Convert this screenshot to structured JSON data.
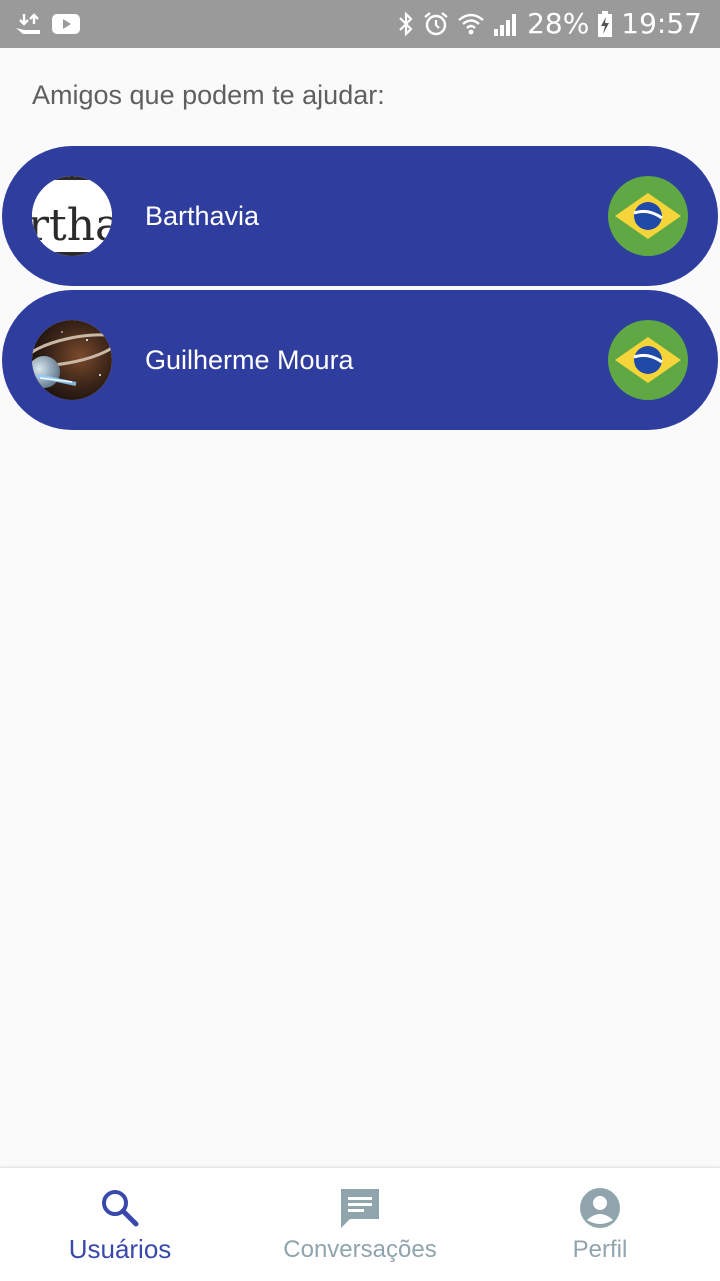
{
  "status_bar": {
    "battery_percent": "28%",
    "time": "19:57",
    "left_icons": [
      "download-upload-icon",
      "youtube-icon"
    ],
    "right_icons": [
      "bluetooth-icon",
      "alarm-icon",
      "wifi-icon",
      "signal-icon",
      "battery-charging-icon"
    ]
  },
  "main": {
    "title": "Amigos que podem te ajudar:",
    "friends": [
      {
        "name": "Barthavia",
        "avatar_text": "rtha",
        "flag": "brazil-flag-icon"
      },
      {
        "name": "Guilherme Moura",
        "avatar": "planet-avatar",
        "flag": "brazil-flag-icon"
      }
    ]
  },
  "bottom_nav": {
    "items": [
      {
        "label": "Usuários",
        "icon": "search-icon",
        "active": true
      },
      {
        "label": "Conversações",
        "icon": "chat-icon",
        "active": false
      },
      {
        "label": "Perfil",
        "icon": "account-icon",
        "active": false
      }
    ]
  },
  "colors": {
    "card_background": "#2f3d9f",
    "active_nav": "#3949ab",
    "inactive_nav": "#90a4ae",
    "status_bar": "#9a9a9a",
    "flag_green": "#5fa843",
    "flag_yellow": "#f5d43a",
    "flag_blue": "#1f4aa8"
  }
}
